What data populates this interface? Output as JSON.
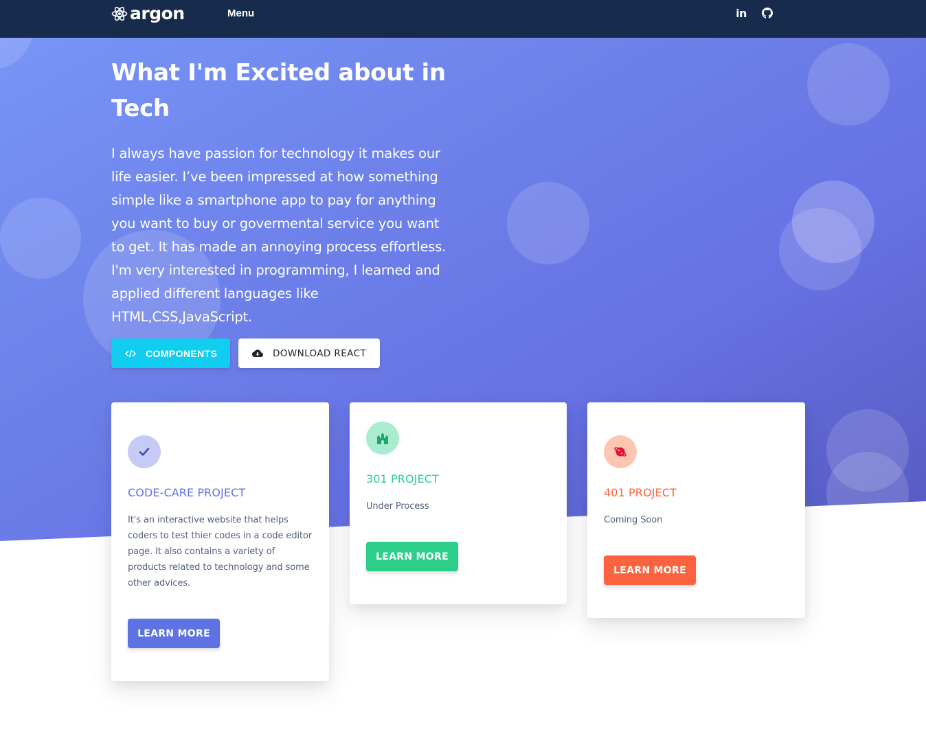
{
  "navbar": {
    "brand": "argon",
    "menu_label": "Menu",
    "social": [
      {
        "icon": "linkedin-icon",
        "label": "in"
      },
      {
        "icon": "github-icon"
      }
    ]
  },
  "hero": {
    "title": "What I'm Excited about in Tech",
    "lead": "I always have passion for technology it makes our life easier. I’ve been impressed at how something simple like a smartphone app to pay for anything you want to buy or govermental service you want to get. It has made an annoying process effortless. I'm very interested in programming, I learned and applied different languages like HTML,CSS,JavaScript.",
    "buttons": {
      "components": "COMPONENTS",
      "download": "DOWNLOAD REACT"
    }
  },
  "cards": [
    {
      "title": "CODE-CARE PROJECT",
      "description": "It's an interactive website that helps coders to test thier codes in a code editor page. It also contains a variety of products related to technology and some other advices.",
      "button": "LEARN MORE",
      "icon": "check-icon",
      "color": "#5e72e4"
    },
    {
      "title": "301 PROJECT",
      "description": "Under Process",
      "button": "LEARN MORE",
      "icon": "building-icon",
      "color": "#2dce89"
    },
    {
      "title": "401 PROJECT",
      "description": "Coming Soon",
      "button": "LEARN MORE",
      "icon": "planet-icon",
      "color": "#fb6340"
    }
  ],
  "colors": {
    "navbar_bg": "#172b4d",
    "info": "#11cdef",
    "primary": "#5e72e4",
    "success": "#2dce89",
    "warning": "#fb6340"
  }
}
